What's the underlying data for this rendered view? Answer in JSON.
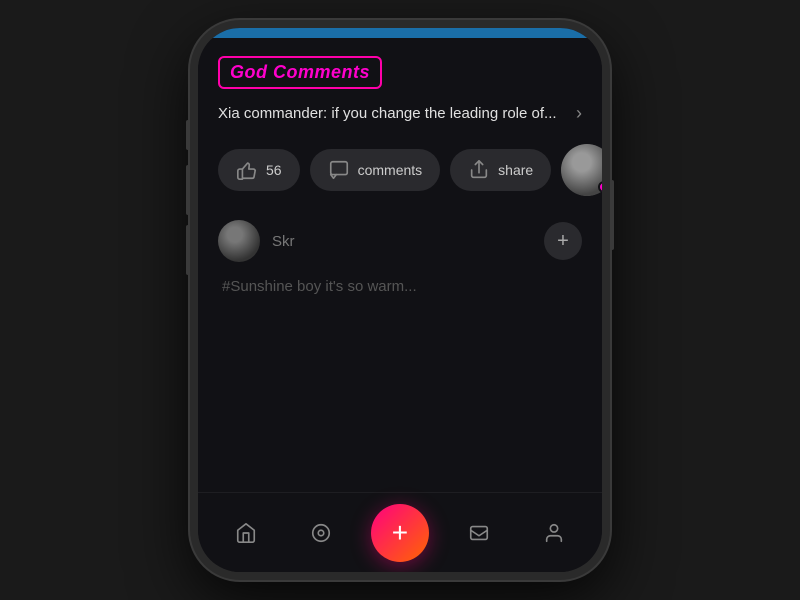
{
  "phone": {
    "top_bar_color": "#1a6ea8"
  },
  "god_comments": {
    "badge_label": "God Comments",
    "article_title": "Xia commander: if you change the leading role of...",
    "chevron": "›"
  },
  "actions": {
    "like_count": "56",
    "comments_label": "comments",
    "share_label": "share",
    "add_label": "+"
  },
  "comment": {
    "username": "Skr",
    "hashtag": "#Sunshine boy it's so warm..."
  },
  "bottom_nav": {
    "home_label": "Home",
    "explore_label": "Explore",
    "add_label": "+",
    "messages_label": "Messages",
    "profile_label": "Profile"
  }
}
